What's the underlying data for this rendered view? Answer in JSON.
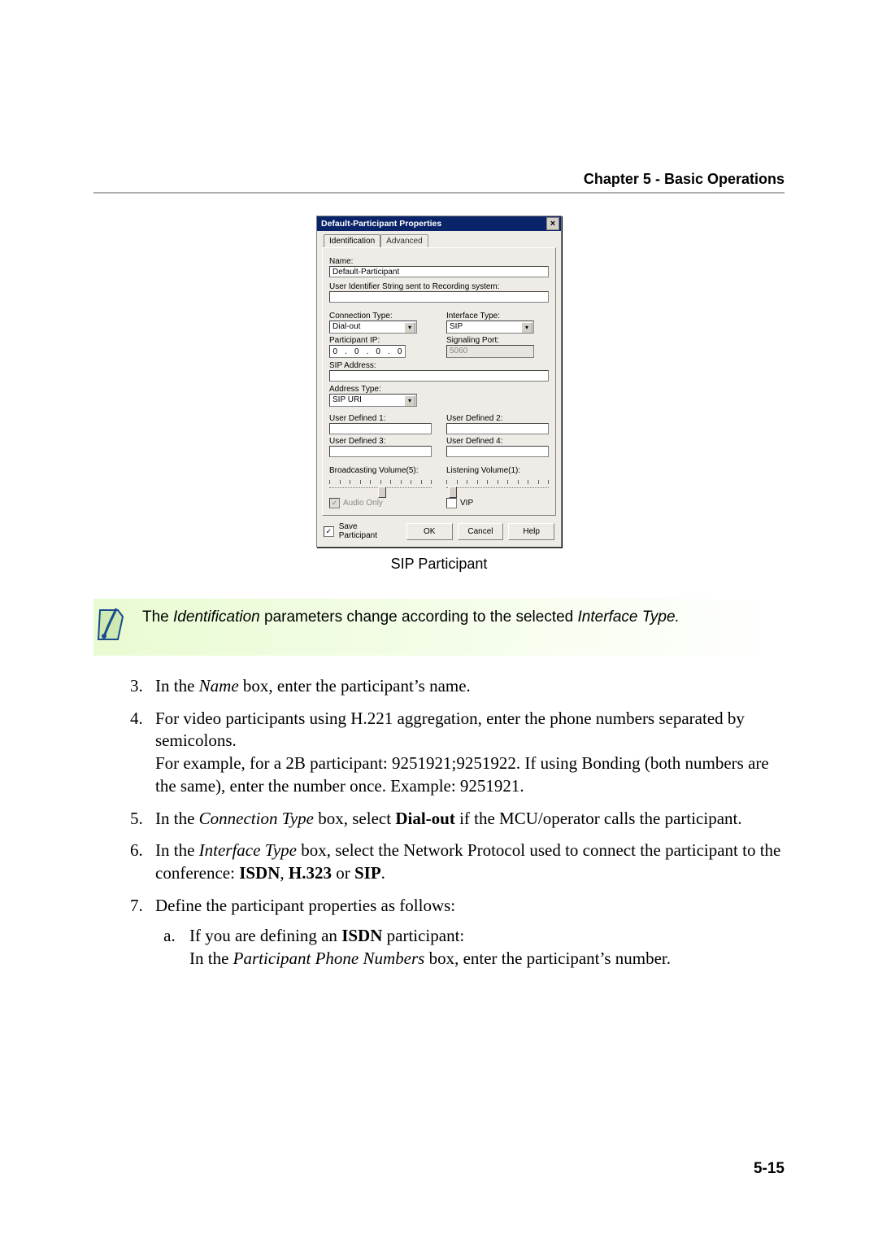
{
  "header": "Chapter 5 - Basic Operations",
  "page_number": "5-15",
  "dialog": {
    "title": "Default-Participant Properties",
    "tabs": [
      "Identification",
      "Advanced"
    ],
    "labels": {
      "name": "Name:",
      "user_id": "User Identifier String sent to Recording system:",
      "conn_type": "Connection Type:",
      "iface_type": "Interface Type:",
      "part_ip": "Participant IP:",
      "sig_port": "Signaling Port:",
      "sip_addr": "SIP Address:",
      "addr_type": "Address Type:",
      "ud1": "User Defined 1:",
      "ud2": "User Defined 2:",
      "ud3": "User Defined 3:",
      "ud4": "User Defined 4:",
      "bvol": "Broadcasting Volume(5):",
      "lvol": "Listening Volume(1):",
      "audio_only": "Audio Only",
      "vip": "VIP",
      "save": "Save Participant"
    },
    "values": {
      "name": "Default-Participant",
      "conn_type": "Dial-out",
      "iface_type": "SIP",
      "sig_port": "5060",
      "addr_type": "SIP URI",
      "ip": [
        "0",
        "0",
        "0",
        "0"
      ]
    },
    "buttons": {
      "ok": "OK",
      "cancel": "Cancel",
      "help": "Help"
    },
    "close": "×"
  },
  "figure_caption": "SIP Participant",
  "note": {
    "pre": "The ",
    "em1": "Identification",
    "mid": " parameters change according to the selected ",
    "em2": "Interface Type.",
    "post": ""
  },
  "steps": {
    "s3": {
      "a": "In the ",
      "em": "Name",
      "b": " box, enter the participant’s name."
    },
    "s4": {
      "line1": "For video participants using H.221 aggregation, enter the phone numbers separated by semicolons.",
      "line2": "For example, for a 2B participant: 9251921;9251922. If using Bonding (both numbers are the same), enter the number once. Example: 9251921."
    },
    "s5": {
      "a": "In the ",
      "em": "Connection Type",
      "b": " box, select ",
      "bold": "Dial-out",
      "c": " if the MCU/operator calls the participant."
    },
    "s6": {
      "a": "In the ",
      "em": "Interface Type",
      "b": " box, select the Network Protocol used to connect the participant to the conference: ",
      "b1": "ISDN",
      "c1": ", ",
      "b2": "H.323",
      "c2": " or ",
      "b3": "SIP",
      "c3": "."
    },
    "s7": "Define the participant properties as follows:",
    "s7a": {
      "a": "If you are defining an ",
      "b1": "ISDN",
      "b": " participant:",
      "c": "In the ",
      "em": "Participant Phone Numbers",
      "d": " box, enter the participant’s number."
    }
  }
}
